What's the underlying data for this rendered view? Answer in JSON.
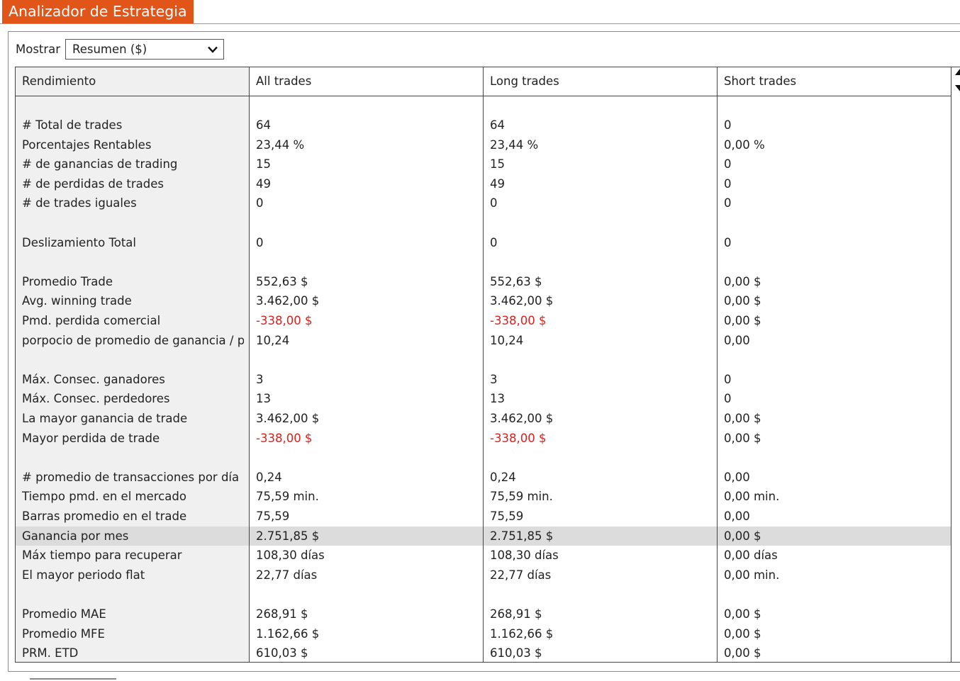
{
  "window": {
    "title": "Analizador de Estrategia"
  },
  "toolbar": {
    "show_label": "Mostrar",
    "show_value": "Resumen ($)"
  },
  "colors": {
    "accent": "#e25519",
    "negative": "#d9231f",
    "label_column_bg": "#f0f0f0",
    "highlight_row": "#dcdcdc"
  },
  "table": {
    "columns": [
      "Rendimiento",
      "All trades",
      "Long trades",
      "Short trades"
    ],
    "rows": [
      {
        "label": "# Total de trades",
        "values": [
          "64",
          "64",
          "0"
        ],
        "neg": [
          false,
          false,
          false
        ]
      },
      {
        "label": "Porcentajes Rentables",
        "values": [
          "23,44 %",
          "23,44 %",
          "0,00 %"
        ],
        "neg": [
          false,
          false,
          false
        ]
      },
      {
        "label": "# de ganancias de trading",
        "values": [
          "15",
          "15",
          "0"
        ],
        "neg": [
          false,
          false,
          false
        ]
      },
      {
        "label": "# de perdidas de trades",
        "values": [
          "49",
          "49",
          "0"
        ],
        "neg": [
          false,
          false,
          false
        ]
      },
      {
        "label": "# de trades iguales",
        "values": [
          "0",
          "0",
          "0"
        ],
        "neg": [
          false,
          false,
          false
        ]
      },
      {
        "label": "",
        "values": [
          "",
          "",
          ""
        ],
        "neg": [
          false,
          false,
          false
        ]
      },
      {
        "label": "Deslizamiento Total",
        "values": [
          "0",
          "0",
          "0"
        ],
        "neg": [
          false,
          false,
          false
        ]
      },
      {
        "label": "",
        "values": [
          "",
          "",
          ""
        ],
        "neg": [
          false,
          false,
          false
        ]
      },
      {
        "label": "Promedio Trade",
        "values": [
          "552,63 $",
          "552,63 $",
          "0,00 $"
        ],
        "neg": [
          false,
          false,
          false
        ]
      },
      {
        "label": "Avg. winning trade",
        "values": [
          "3.462,00 $",
          "3.462,00 $",
          "0,00 $"
        ],
        "neg": [
          false,
          false,
          false
        ]
      },
      {
        "label": "Pmd. perdida comercial",
        "values": [
          "-338,00 $",
          "-338,00 $",
          "0,00 $"
        ],
        "neg": [
          true,
          true,
          false
        ]
      },
      {
        "label": "porpocio de promedio de ganancia / pérdida",
        "values": [
          "10,24",
          "10,24",
          "0,00"
        ],
        "neg": [
          false,
          false,
          false
        ]
      },
      {
        "label": "",
        "values": [
          "",
          "",
          ""
        ],
        "neg": [
          false,
          false,
          false
        ]
      },
      {
        "label": "Máx. Consec. ganadores",
        "values": [
          "3",
          "3",
          "0"
        ],
        "neg": [
          false,
          false,
          false
        ]
      },
      {
        "label": "Máx. Consec. perdedores",
        "values": [
          "13",
          "13",
          "0"
        ],
        "neg": [
          false,
          false,
          false
        ]
      },
      {
        "label": "La mayor ganancia de trade",
        "values": [
          "3.462,00 $",
          "3.462,00 $",
          "0,00 $"
        ],
        "neg": [
          false,
          false,
          false
        ]
      },
      {
        "label": "Mayor perdida de trade",
        "values": [
          "-338,00 $",
          "-338,00 $",
          "0,00 $"
        ],
        "neg": [
          true,
          true,
          false
        ]
      },
      {
        "label": "",
        "values": [
          "",
          "",
          ""
        ],
        "neg": [
          false,
          false,
          false
        ]
      },
      {
        "label": "# promedio de transacciones por día",
        "values": [
          "0,24",
          "0,24",
          "0,00"
        ],
        "neg": [
          false,
          false,
          false
        ]
      },
      {
        "label": "Tiempo pmd. en el mercado",
        "values": [
          "75,59 min.",
          "75,59 min.",
          "0,00 min."
        ],
        "neg": [
          false,
          false,
          false
        ]
      },
      {
        "label": "Barras promedio en el trade",
        "values": [
          "75,59",
          "75,59",
          "0,00"
        ],
        "neg": [
          false,
          false,
          false
        ]
      },
      {
        "label": "Ganancia por mes",
        "values": [
          "2.751,85 $",
          "2.751,85 $",
          "0,00 $"
        ],
        "neg": [
          false,
          false,
          false
        ],
        "highlight": true
      },
      {
        "label": "Máx tiempo para recuperar",
        "values": [
          "108,30 días",
          "108,30 días",
          "0,00 días"
        ],
        "neg": [
          false,
          false,
          false
        ]
      },
      {
        "label": "El mayor periodo flat",
        "values": [
          "22,77 días",
          "22,77 días",
          "0,00 min."
        ],
        "neg": [
          false,
          false,
          false
        ]
      },
      {
        "label": "",
        "values": [
          "",
          "",
          ""
        ],
        "neg": [
          false,
          false,
          false
        ]
      },
      {
        "label": "Promedio MAE",
        "values": [
          "268,91 $",
          "268,91 $",
          "0,00 $"
        ],
        "neg": [
          false,
          false,
          false
        ]
      },
      {
        "label": "Promedio MFE",
        "values": [
          "1.162,66 $",
          "1.162,66 $",
          "0,00 $"
        ],
        "neg": [
          false,
          false,
          false
        ]
      },
      {
        "label": "PRM. ETD",
        "values": [
          "610,03 $",
          "610,03 $",
          "0,00 $"
        ],
        "neg": [
          false,
          false,
          false
        ]
      }
    ]
  }
}
